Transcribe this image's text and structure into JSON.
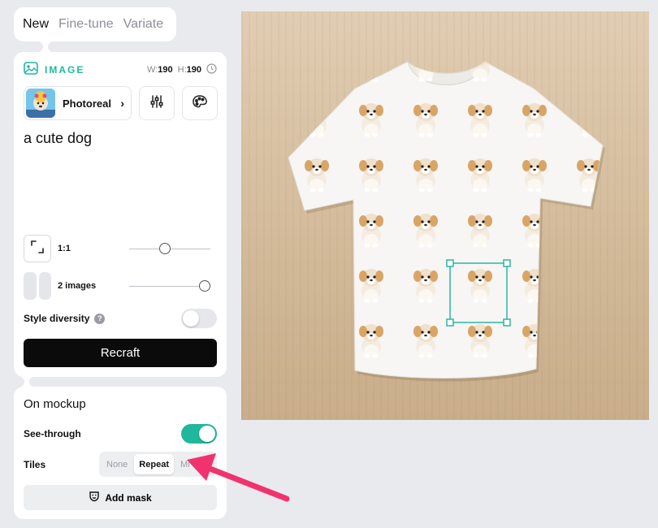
{
  "tabs": [
    {
      "label": "New",
      "active": true
    },
    {
      "label": "Fine-tune",
      "active": false
    },
    {
      "label": "Variate",
      "active": false
    }
  ],
  "image_section": {
    "label": "IMAGE",
    "width_label": "W:",
    "width_value": "190",
    "height_label": "H:",
    "height_value": "190",
    "icon": "image-icon"
  },
  "style": {
    "name": "Photoreal",
    "chevron": "›"
  },
  "prompt": "a cute dog",
  "aspect_ratio": {
    "label": "1:1",
    "slider_fraction": 0.43
  },
  "image_count": {
    "label": "2 images",
    "slider_fraction": 1.0
  },
  "style_diversity": {
    "label": "Style diversity",
    "help": "?",
    "enabled": false
  },
  "recraft_button": "Recraft",
  "mockup": {
    "title": "On mockup",
    "see_through": {
      "label": "See-through",
      "enabled": true
    },
    "tiles": {
      "label": "Tiles",
      "options": [
        "None",
        "Repeat",
        "Mi"
      ],
      "selected": "Repeat"
    },
    "add_mask_label": "Add mask"
  },
  "colors": {
    "accent": "#1fb89c",
    "selection": "#2bb5a3",
    "arrow": "#f0336f",
    "primary_button": "#0b0b0c"
  }
}
